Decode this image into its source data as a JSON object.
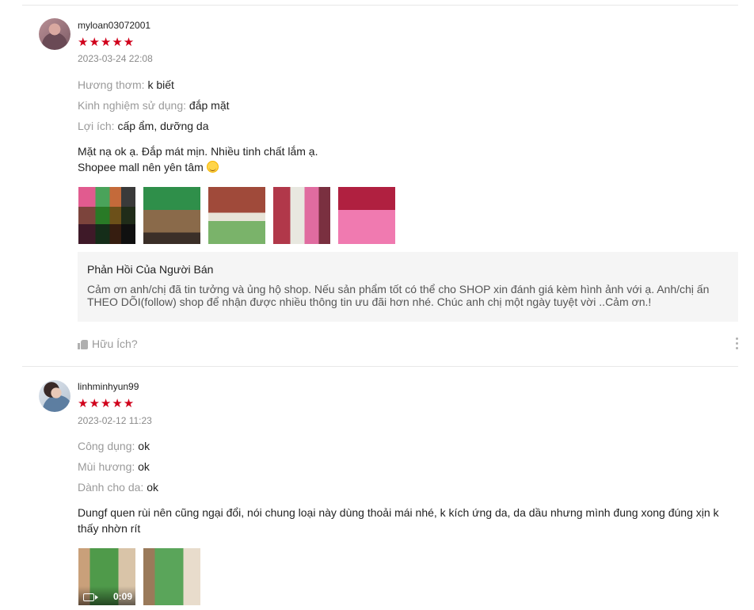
{
  "reviews": [
    {
      "username": "myloan03072001",
      "stars": "★★★★★",
      "rating": 5,
      "date": "2023-03-24 22:08",
      "attributes": [
        {
          "key": "Hương thơm:",
          "value": "k biết"
        },
        {
          "key": "Kinh nghiệm sử dụng:",
          "value": "đắp mặt"
        },
        {
          "key": "Lợi ích:",
          "value": "cấp ẩm, dưỡng da"
        }
      ],
      "content_line1": "Mặt nạ ok ạ. Đắp mát mịn. Nhiều tinh chất lắm ạ.",
      "content_line2": "Shopee mall nên yên tâm",
      "reply_title": "Phản Hồi Của Người Bán",
      "reply_text": "Cảm ơn anh/chị đã tin tưởng và ủng hộ shop. Nếu sản phẩm tốt có thể cho SHOP xin đánh giá kèm hình ảnh với ạ. Anh/chị ấn THEO DÕI(follow) shop để nhận được nhiều thông tin ưu đãi hơn nhé.  Chúc anh chị một ngày tuyệt vời ..Cảm ơn.!",
      "helpful_label": "Hữu Ích?"
    },
    {
      "username": "linhminhyun99",
      "stars": "★★★★★",
      "rating": 5,
      "date": "2023-02-12 11:23",
      "attributes": [
        {
          "key": "Công dụng:",
          "value": "ok"
        },
        {
          "key": "Mùi hương:",
          "value": "ok"
        },
        {
          "key": "Dành cho da:",
          "value": "ok"
        }
      ],
      "content": "Dungf quen rùi nên cũng ngại đổi, nói chung loại này dùng thoải mái nhé, k kích ứng da, da dầu nhưng mình đung xong đúng xịn k thấy nhờn rít",
      "video_duration": "0:09"
    }
  ],
  "colors": {
    "star": "#d0011b",
    "muted": "#9a9a9a",
    "reply_bg": "#f5f5f5"
  }
}
